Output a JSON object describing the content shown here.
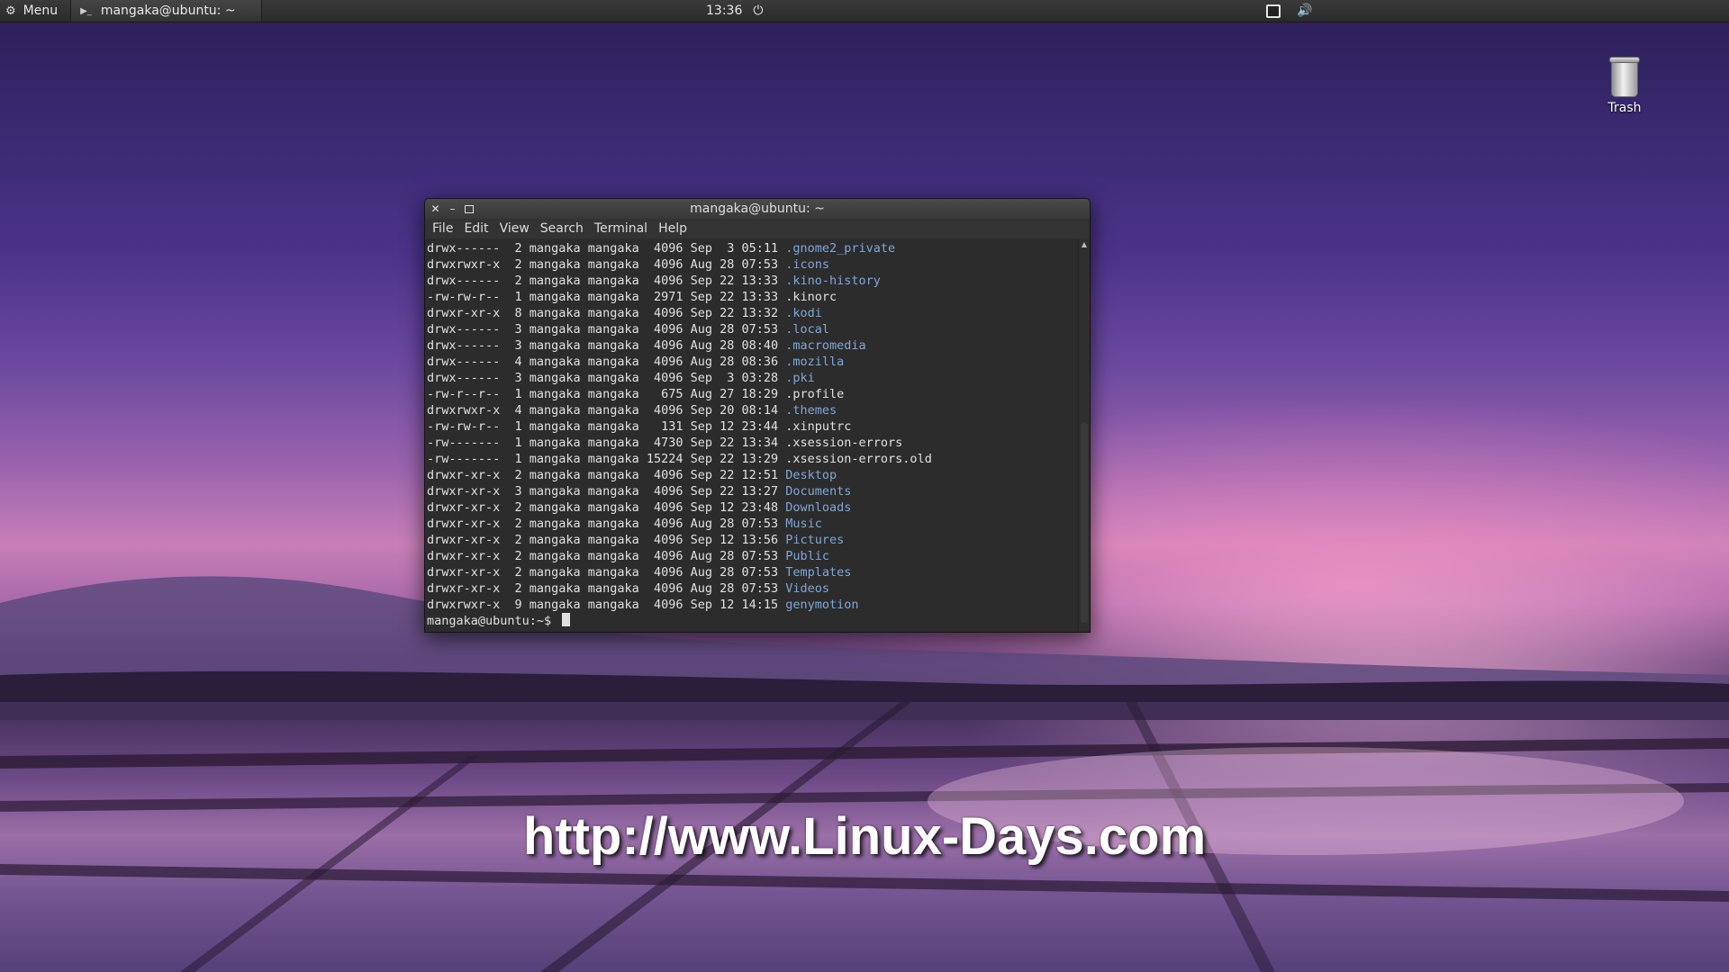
{
  "panel": {
    "menu_label": "Menu",
    "menu_icon": "ubuntu-logo-icon",
    "task_label": "mangaka@ubuntu: ~",
    "task_icon": "terminal-icon",
    "clock": "13:36",
    "power_icon": "power-icon",
    "tray": [
      "display-icon",
      "volume-icon"
    ]
  },
  "desktop": {
    "trash_label": "Trash",
    "watermark": "http://www.Linux-Days.com"
  },
  "terminal": {
    "title": "mangaka@ubuntu: ~",
    "menu": [
      "File",
      "Edit",
      "View",
      "Search",
      "Terminal",
      "Help"
    ],
    "lines": [
      {
        "meta": "drwx------  2 mangaka mangaka  4096 Sep  3 05:11 ",
        "name": ".gnome2_private",
        "type": "dir"
      },
      {
        "meta": "drwxrwxr-x  2 mangaka mangaka  4096 Aug 28 07:53 ",
        "name": ".icons",
        "type": "dir"
      },
      {
        "meta": "drwx------  2 mangaka mangaka  4096 Sep 22 13:33 ",
        "name": ".kino-history",
        "type": "dir"
      },
      {
        "meta": "-rw-rw-r--  1 mangaka mangaka  2971 Sep 22 13:33 ",
        "name": ".kinorc",
        "type": "file"
      },
      {
        "meta": "drwxr-xr-x  8 mangaka mangaka  4096 Sep 22 13:32 ",
        "name": ".kodi",
        "type": "dir"
      },
      {
        "meta": "drwx------  3 mangaka mangaka  4096 Aug 28 07:53 ",
        "name": ".local",
        "type": "dir"
      },
      {
        "meta": "drwx------  3 mangaka mangaka  4096 Aug 28 08:40 ",
        "name": ".macromedia",
        "type": "dir"
      },
      {
        "meta": "drwx------  4 mangaka mangaka  4096 Aug 28 08:36 ",
        "name": ".mozilla",
        "type": "dir"
      },
      {
        "meta": "drwx------  3 mangaka mangaka  4096 Sep  3 03:28 ",
        "name": ".pki",
        "type": "dir"
      },
      {
        "meta": "-rw-r--r--  1 mangaka mangaka   675 Aug 27 18:29 ",
        "name": ".profile",
        "type": "file"
      },
      {
        "meta": "drwxrwxr-x  4 mangaka mangaka  4096 Sep 20 08:14 ",
        "name": ".themes",
        "type": "dir"
      },
      {
        "meta": "-rw-rw-r--  1 mangaka mangaka   131 Sep 12 23:44 ",
        "name": ".xinputrc",
        "type": "file"
      },
      {
        "meta": "-rw-------  1 mangaka mangaka  4730 Sep 22 13:34 ",
        "name": ".xsession-errors",
        "type": "file"
      },
      {
        "meta": "-rw-------  1 mangaka mangaka 15224 Sep 22 13:29 ",
        "name": ".xsession-errors.old",
        "type": "file"
      },
      {
        "meta": "drwxr-xr-x  2 mangaka mangaka  4096 Sep 22 12:51 ",
        "name": "Desktop",
        "type": "dir"
      },
      {
        "meta": "drwxr-xr-x  3 mangaka mangaka  4096 Sep 22 13:27 ",
        "name": "Documents",
        "type": "dir"
      },
      {
        "meta": "drwxr-xr-x  2 mangaka mangaka  4096 Sep 12 23:48 ",
        "name": "Downloads",
        "type": "dir"
      },
      {
        "meta": "drwxr-xr-x  2 mangaka mangaka  4096 Aug 28 07:53 ",
        "name": "Music",
        "type": "dir"
      },
      {
        "meta": "drwxr-xr-x  2 mangaka mangaka  4096 Sep 12 13:56 ",
        "name": "Pictures",
        "type": "dir"
      },
      {
        "meta": "drwxr-xr-x  2 mangaka mangaka  4096 Aug 28 07:53 ",
        "name": "Public",
        "type": "dir"
      },
      {
        "meta": "drwxr-xr-x  2 mangaka mangaka  4096 Aug 28 07:53 ",
        "name": "Templates",
        "type": "dir"
      },
      {
        "meta": "drwxr-xr-x  2 mangaka mangaka  4096 Aug 28 07:53 ",
        "name": "Videos",
        "type": "dir"
      },
      {
        "meta": "drwxrwxr-x  9 mangaka mangaka  4096 Sep 12 14:15 ",
        "name": "genymotion",
        "type": "dir"
      }
    ],
    "prompt": "mangaka@ubuntu:~$ "
  },
  "colors": {
    "dir_color": "#7fa7d8",
    "terminal_bg": "#2c2c2c",
    "panel_bg": "#2f2f2f"
  }
}
